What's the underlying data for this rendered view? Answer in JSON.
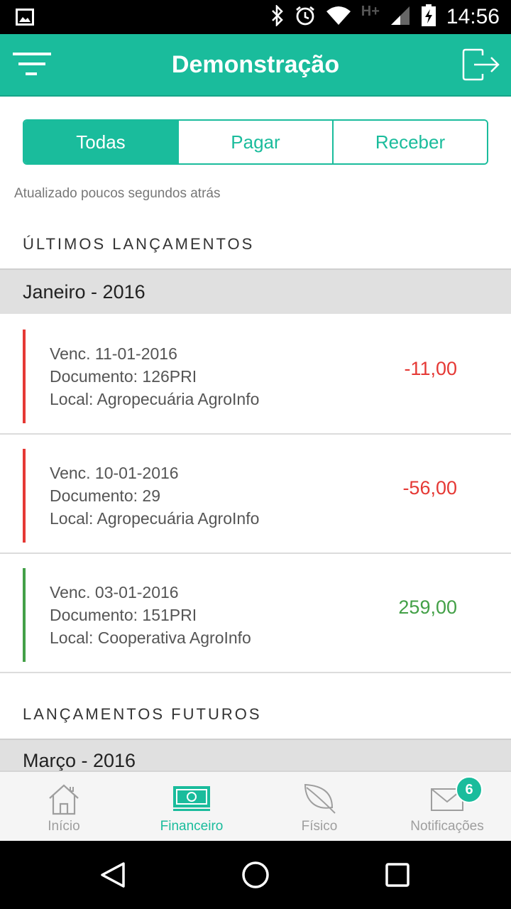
{
  "colors": {
    "accent": "#1abc9c",
    "negative": "#e53935",
    "positive": "#43a047",
    "status_bar": "#000000"
  },
  "status_bar": {
    "time": "14:56",
    "network_label": "H+",
    "icons": [
      "image-icon",
      "bluetooth-icon",
      "alarm-icon",
      "wifi-icon",
      "signal-icon",
      "battery-icon"
    ]
  },
  "app_bar": {
    "title": "Demonstração",
    "menu_icon": "filter-menu-icon",
    "logout_icon": "logout-icon"
  },
  "tabs": [
    {
      "label": "Todas",
      "active": true
    },
    {
      "label": "Pagar",
      "active": false
    },
    {
      "label": "Receber",
      "active": false
    }
  ],
  "updated_text": "Atualizado poucos segundos atrás",
  "sections": {
    "latest": {
      "title": "ÚLTIMOS LANÇAMENTOS",
      "month": "Janeiro - 2016",
      "entries": [
        {
          "due": "Venc. 11-01-2016",
          "document": "Documento: 126PRI",
          "local": "Local: Agropecuária AgroInfo",
          "amount": "-11,00",
          "type": "negative"
        },
        {
          "due": "Venc. 10-01-2016",
          "document": "Documento: 29",
          "local": "Local: Agropecuária AgroInfo",
          "amount": "-56,00",
          "type": "negative"
        },
        {
          "due": "Venc. 03-01-2016",
          "document": "Documento: 151PRI",
          "local": "Local: Cooperativa AgroInfo",
          "amount": "259,00",
          "type": "positive"
        }
      ]
    },
    "future": {
      "title": "LANÇAMENTOS FUTUROS",
      "month": "Março - 2016"
    }
  },
  "bottom_nav": [
    {
      "label": "Início",
      "icon": "home-icon",
      "active": false
    },
    {
      "label": "Financeiro",
      "icon": "money-icon",
      "active": true
    },
    {
      "label": "Físico",
      "icon": "leaf-icon",
      "active": false
    },
    {
      "label": "Notificações",
      "icon": "mail-icon",
      "active": false,
      "badge": "6"
    }
  ],
  "system_nav": [
    "back-icon",
    "home-circle-icon",
    "recents-icon"
  ]
}
